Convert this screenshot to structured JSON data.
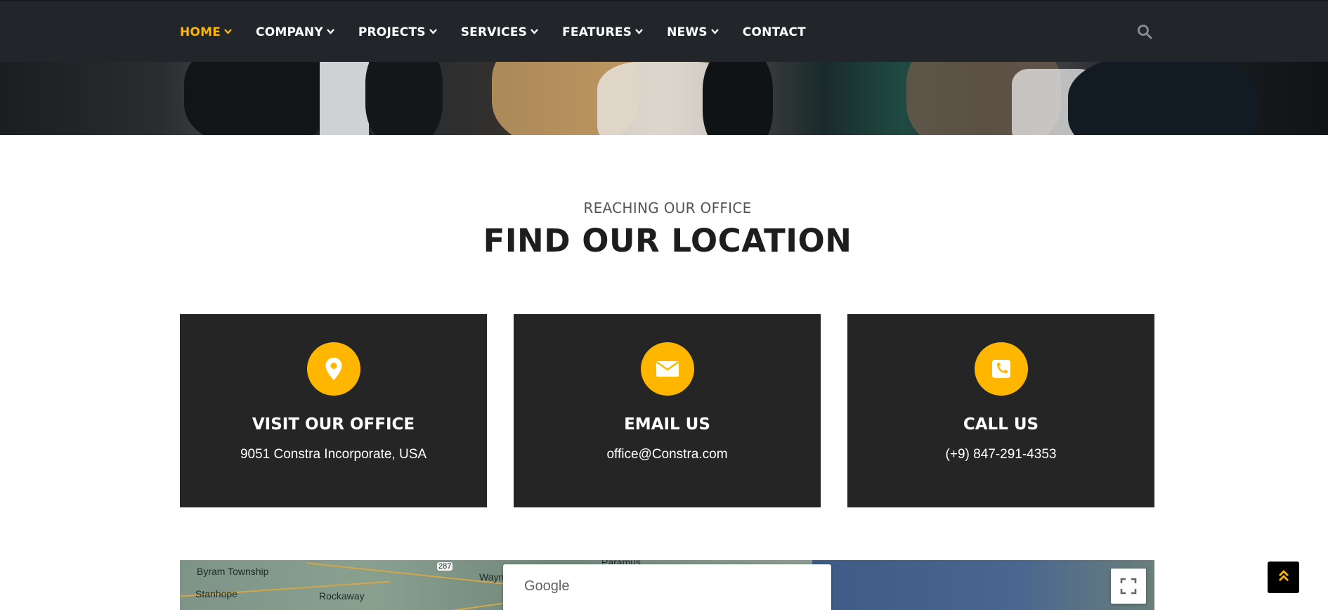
{
  "nav": {
    "items": [
      {
        "label": "HOME",
        "has_dropdown": true,
        "active": true
      },
      {
        "label": "COMPANY",
        "has_dropdown": true
      },
      {
        "label": "PROJECTS",
        "has_dropdown": true
      },
      {
        "label": "SERVICES",
        "has_dropdown": true
      },
      {
        "label": "FEATURES",
        "has_dropdown": true
      },
      {
        "label": "NEWS",
        "has_dropdown": true
      },
      {
        "label": "CONTACT",
        "has_dropdown": false
      }
    ],
    "search_icon": "search-icon"
  },
  "section": {
    "eyebrow": "REACHING OUR OFFICE",
    "title": "FIND OUR LOCATION"
  },
  "cards": [
    {
      "icon": "map-marker-icon",
      "title": "VISIT OUR OFFICE",
      "text": "9051 Constra Incorporate, USA"
    },
    {
      "icon": "envelope-icon",
      "title": "EMAIL US",
      "text": "office@Constra.com"
    },
    {
      "icon": "phone-icon",
      "title": "CALL US",
      "text": "(+9) 847-291-4353"
    }
  ],
  "map": {
    "places": [
      "Byram Township",
      "Stanhope",
      "Rockaway",
      "Wayn",
      "Paramus",
      "287"
    ],
    "google_label": "Google",
    "fullscreen_icon": "fullscreen-icon"
  },
  "back_to_top_icon": "double-chevron-up-icon",
  "colors": {
    "accent": "#ffb600",
    "navbar": "#22262b",
    "card": "#252525",
    "title": "#1d1d1d"
  }
}
